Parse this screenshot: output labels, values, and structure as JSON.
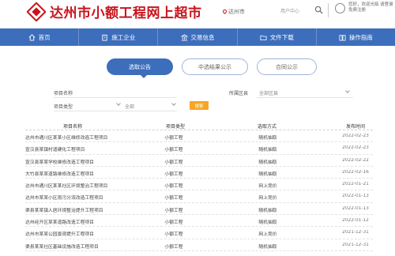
{
  "header": {
    "site_title": "达州市小额工程网上超市",
    "region": "达州市",
    "user_link": "用户中心",
    "user_info": "您好，欢迎光临 请登录 免费注册"
  },
  "nav": {
    "items": [
      {
        "label": "首页",
        "icon": "home-icon"
      },
      {
        "label": "施工企业",
        "icon": "building-icon"
      },
      {
        "label": "交易信息",
        "icon": "bank-icon"
      },
      {
        "label": "文件下载",
        "icon": "folder-icon"
      },
      {
        "label": "操作指南",
        "icon": "book-icon"
      }
    ]
  },
  "tabs": [
    {
      "label": "选取公告",
      "active": true
    },
    {
      "label": "中选结果公示",
      "active": false
    },
    {
      "label": "合同公示",
      "active": false
    }
  ],
  "filters": {
    "project_name_label": "项目名称",
    "region_label": "所属区县",
    "region_value": "全部区县",
    "project_type_label": "项目类型",
    "project_type_value": "全部",
    "search_button": "搜索"
  },
  "table": {
    "headers": {
      "name": "项目名称",
      "type": "项目类型",
      "method": "选取方式",
      "date": "发布时间"
    },
    "rows": [
      {
        "name": "达州市通川区某某小区维修改造工程项目",
        "type": "小额工程",
        "method": "随机抽取",
        "date": "2022-02-23"
      },
      {
        "name": "宣汉县某镇村道硬化工程项目",
        "type": "小额工程",
        "method": "随机抽取",
        "date": "2022-02-23"
      },
      {
        "name": "宣汉县某某学校维修改造工程项目",
        "type": "小额工程",
        "method": "随机抽取",
        "date": "2022-02-22"
      },
      {
        "name": "大竹县某某道路维修改造工程项目",
        "type": "小额工程",
        "method": "随机抽取",
        "date": "2022-02-16"
      },
      {
        "name": "达州市通川区某某社区环境整治工程项目",
        "type": "小额工程",
        "method": "网上竞价",
        "date": "2022-01-21"
      },
      {
        "name": "达州市某某小区雨污分流改造工程项目",
        "type": "小额工程",
        "method": "网上竞价",
        "date": "2022-01-13"
      },
      {
        "name": "渠县某某镇人居环境整治提升工程项目",
        "type": "小额工程",
        "method": "随机抽取",
        "date": "2022-01-13"
      },
      {
        "name": "达州经开区某某道路改造工程项目",
        "type": "小额工程",
        "method": "随机抽取",
        "date": "2022-01-12"
      },
      {
        "name": "达州市某某公园景观提升工程项目",
        "type": "小额工程",
        "method": "网上竞价",
        "date": "2021-12-31"
      },
      {
        "name": "渠县某某社区基础设施改造工程项目",
        "type": "小额工程",
        "method": "随机抽取",
        "date": "2021-12-31"
      }
    ]
  },
  "colors": {
    "brand_red": "#c8141c",
    "nav_blue": "#3c6ebc",
    "search_orange": "#f5a623"
  }
}
